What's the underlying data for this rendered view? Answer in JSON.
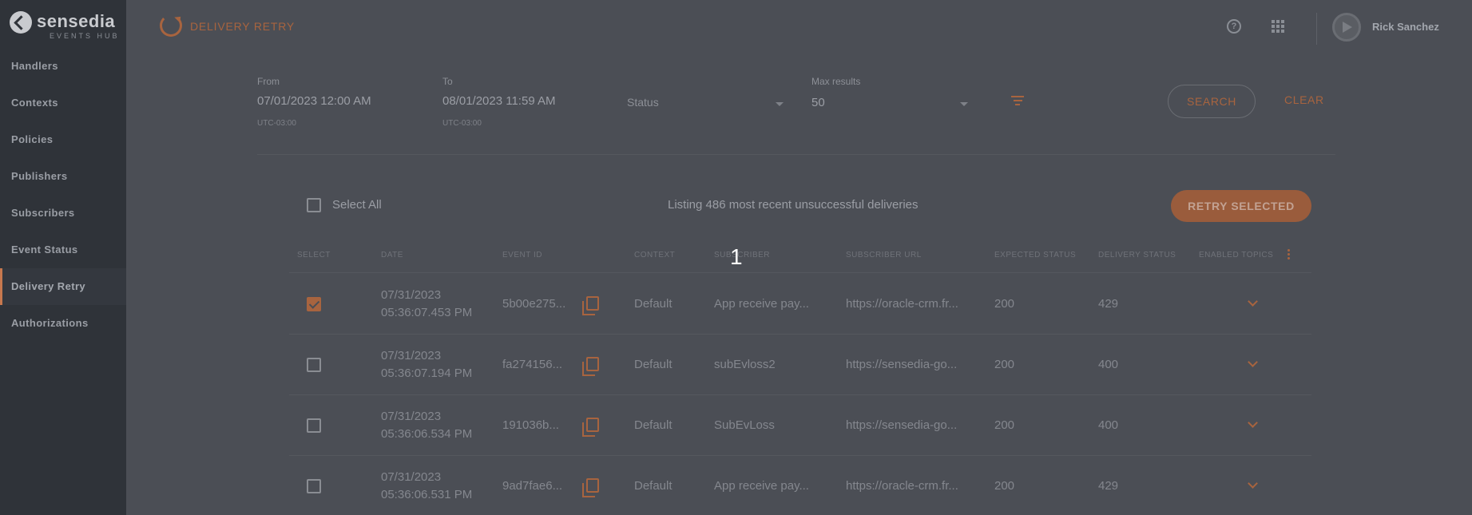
{
  "brand": {
    "name": "sensedia",
    "subtitle": "EVENTS HUB"
  },
  "sidebar": {
    "items": [
      {
        "label": "Handlers"
      },
      {
        "label": "Contexts"
      },
      {
        "label": "Policies"
      },
      {
        "label": "Publishers"
      },
      {
        "label": "Subscribers"
      },
      {
        "label": "Event Status"
      },
      {
        "label": "Delivery Retry",
        "active": true
      },
      {
        "label": "Authorizations"
      }
    ]
  },
  "header": {
    "title": "DELIVERY RETRY",
    "user_name": "Rick Sanchez"
  },
  "filters": {
    "from": {
      "label": "From",
      "value": "07/01/2023 12:00 AM",
      "hint": "UTC-03:00"
    },
    "to": {
      "label": "To",
      "value": "08/01/2023 11:59 AM",
      "hint": "UTC-03:00"
    },
    "status": {
      "placeholder": "Status"
    },
    "max_results": {
      "label": "Max results",
      "value": "50"
    },
    "search_label": "SEARCH",
    "clear_label": "CLEAR"
  },
  "table": {
    "select_all_label": "Select All",
    "listing_text": "Listing 486 most recent unsuccessful deliveries",
    "retry_label": "RETRY SELECTED",
    "overlay_number": "1",
    "columns": [
      "SELECT",
      "DATE",
      "EVENT ID",
      "CONTEXT",
      "SUBSCRIBER",
      "SUBSCRIBER URL",
      "EXPECTED STATUS",
      "DELIVERY STATUS",
      "ENABLED TOPICS"
    ],
    "rows": [
      {
        "checked": true,
        "date": "07/31/2023",
        "time": "05:36:07.453 PM",
        "event_id": "5b00e275...",
        "context": "Default",
        "subscriber": "App receive pay...",
        "url": "https://oracle-crm.fr...",
        "expected": "200",
        "delivery": "429"
      },
      {
        "checked": false,
        "date": "07/31/2023",
        "time": "05:36:07.194 PM",
        "event_id": "fa274156...",
        "context": "Default",
        "subscriber": "subEvloss2",
        "url": "https://sensedia-go...",
        "expected": "200",
        "delivery": "400"
      },
      {
        "checked": false,
        "date": "07/31/2023",
        "time": "05:36:06.534 PM",
        "event_id": "191036b...",
        "context": "Default",
        "subscriber": "SubEvLoss",
        "url": "https://sensedia-go...",
        "expected": "200",
        "delivery": "400"
      },
      {
        "checked": false,
        "date": "07/31/2023",
        "time": "05:36:06.531 PM",
        "event_id": "9ad7fae6...",
        "context": "Default",
        "subscriber": "App receive pay...",
        "url": "https://oracle-crm.fr...",
        "expected": "200",
        "delivery": "429"
      }
    ]
  },
  "colors": {
    "accent": "#a8643f",
    "sidebar": "#2f3339",
    "background": "#4b4e55"
  }
}
